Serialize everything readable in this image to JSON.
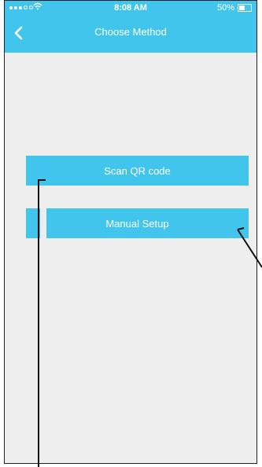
{
  "status_bar": {
    "time": "8:08 AM",
    "battery": "50%",
    "battery_level": 0.5
  },
  "header": {
    "title": "Choose Method",
    "back_icon": "chevron-left-icon"
  },
  "buttons": {
    "scan_qr": "Scan QR code",
    "manual_setup": "Manual Setup"
  },
  "colors": {
    "accent": "#42c5ec",
    "background": "#eeeeee",
    "text_on_accent": "#ffffff"
  }
}
